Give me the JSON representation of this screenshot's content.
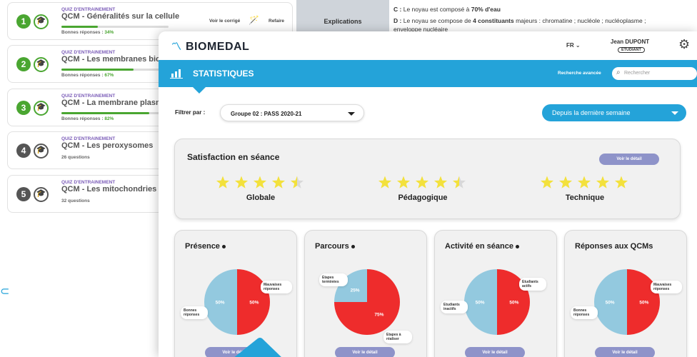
{
  "colors": {
    "accent": "#24a3d9",
    "pie_red": "#ee2c2c",
    "pie_blue": "#93c9df",
    "pill": "#8e93c9",
    "star": "#f3e13c",
    "success": "#4aa631"
  },
  "quizzes": [
    {
      "num": "1",
      "type": "QUIZ D'ENTRAINEMENT",
      "title": "QCM - Généralités sur la cellule",
      "sub_label": "Bonnes réponses :",
      "sub_value": "34%",
      "progress": 0.34,
      "done": true,
      "num_color": "#4aa631",
      "corrige": "Voir le corrigé",
      "refaire": "Refaire"
    },
    {
      "num": "2",
      "type": "QUIZ D'ENTRAINEMENT",
      "title": "QCM - Les membranes biologiques",
      "sub_label": "Bonnes réponses :",
      "sub_value": "67%",
      "progress": 0.67,
      "done": true,
      "num_color": "#4aa631"
    },
    {
      "num": "3",
      "type": "QUIZ D'ENTRAINEMENT",
      "title": "QCM - La membrane plasmique",
      "sub_label": "Bonnes réponses :",
      "sub_value": "82%",
      "progress": 0.82,
      "done": true,
      "num_color": "#4aa631"
    },
    {
      "num": "4",
      "type": "QUIZ D'ENTRAINEMENT",
      "title": "QCM - Les peroxysomes",
      "sub_label": "26 questions",
      "done": false,
      "num_color": "#555555"
    },
    {
      "num": "5",
      "type": "QUIZ D'ENTRAINEMENT",
      "title": "QCM - Les mitochondries",
      "sub_label": "32 questions",
      "done": false,
      "num_color": "#555555"
    }
  ],
  "explanation": {
    "header": "Explications",
    "line_c_prefix": "C :",
    "line_c_text": "Le noyau est composé à",
    "line_c_bold": "70% d'eau",
    "line_d_prefix": "D :",
    "line_d_text": "Le noyau se compose de",
    "line_d_bold": "4 constituants",
    "line_d_rest": "majeurs : chromatine ; nucléole ; nucléoplasme ;",
    "line_e": "enveloppe nucléaire"
  },
  "header": {
    "logo": "BIOMEDAL",
    "lang": "FR",
    "user_name": "Jean DUPONT",
    "user_role": "ÉTUDIANT"
  },
  "toolbar": {
    "title": "STATISTIQUES",
    "advanced_search": "Recherche avancée",
    "search_placeholder": "Rechercher"
  },
  "filters": {
    "label": "Filtrer par :",
    "group": "Groupe 02 : PASS 2020-21",
    "period": "Depuis la dernière semaine"
  },
  "satisfaction": {
    "title": "Satisfaction en séance",
    "detail": "Voir le détail",
    "ratings": [
      {
        "label": "Globale",
        "stars": 4.5
      },
      {
        "label": "Pédagogique",
        "stars": 4.5
      },
      {
        "label": "Technique",
        "stars": 5
      }
    ]
  },
  "cards": [
    {
      "title": "Présence",
      "info": true,
      "detail": "Voir le détail",
      "slices": [
        {
          "label": "Mauvaises réponses",
          "value": 50,
          "color": "red"
        },
        {
          "label": "Bonnes réponses",
          "value": 50,
          "color": "blue"
        }
      ]
    },
    {
      "title": "Parcours",
      "info": true,
      "detail": "Voir le détail",
      "slices": [
        {
          "label": "Etapes à réaliser",
          "value": 75,
          "color": "red"
        },
        {
          "label": "Etapes terminées",
          "value": 25,
          "color": "blue"
        }
      ]
    },
    {
      "title": "Activité en séance",
      "info": true,
      "detail": "Voir le détail",
      "slices": [
        {
          "label": "Etudiants actifs",
          "value": 50,
          "color": "red"
        },
        {
          "label": "Etudiants inactifs",
          "value": 50,
          "color": "blue"
        }
      ]
    },
    {
      "title": "Réponses aux QCMs",
      "info": false,
      "detail": "Voir le détail",
      "slices": [
        {
          "label": "Mauvaises réponses",
          "value": 50,
          "color": "red"
        },
        {
          "label": "Bonnes réponses",
          "value": 50,
          "color": "blue"
        }
      ]
    }
  ]
}
